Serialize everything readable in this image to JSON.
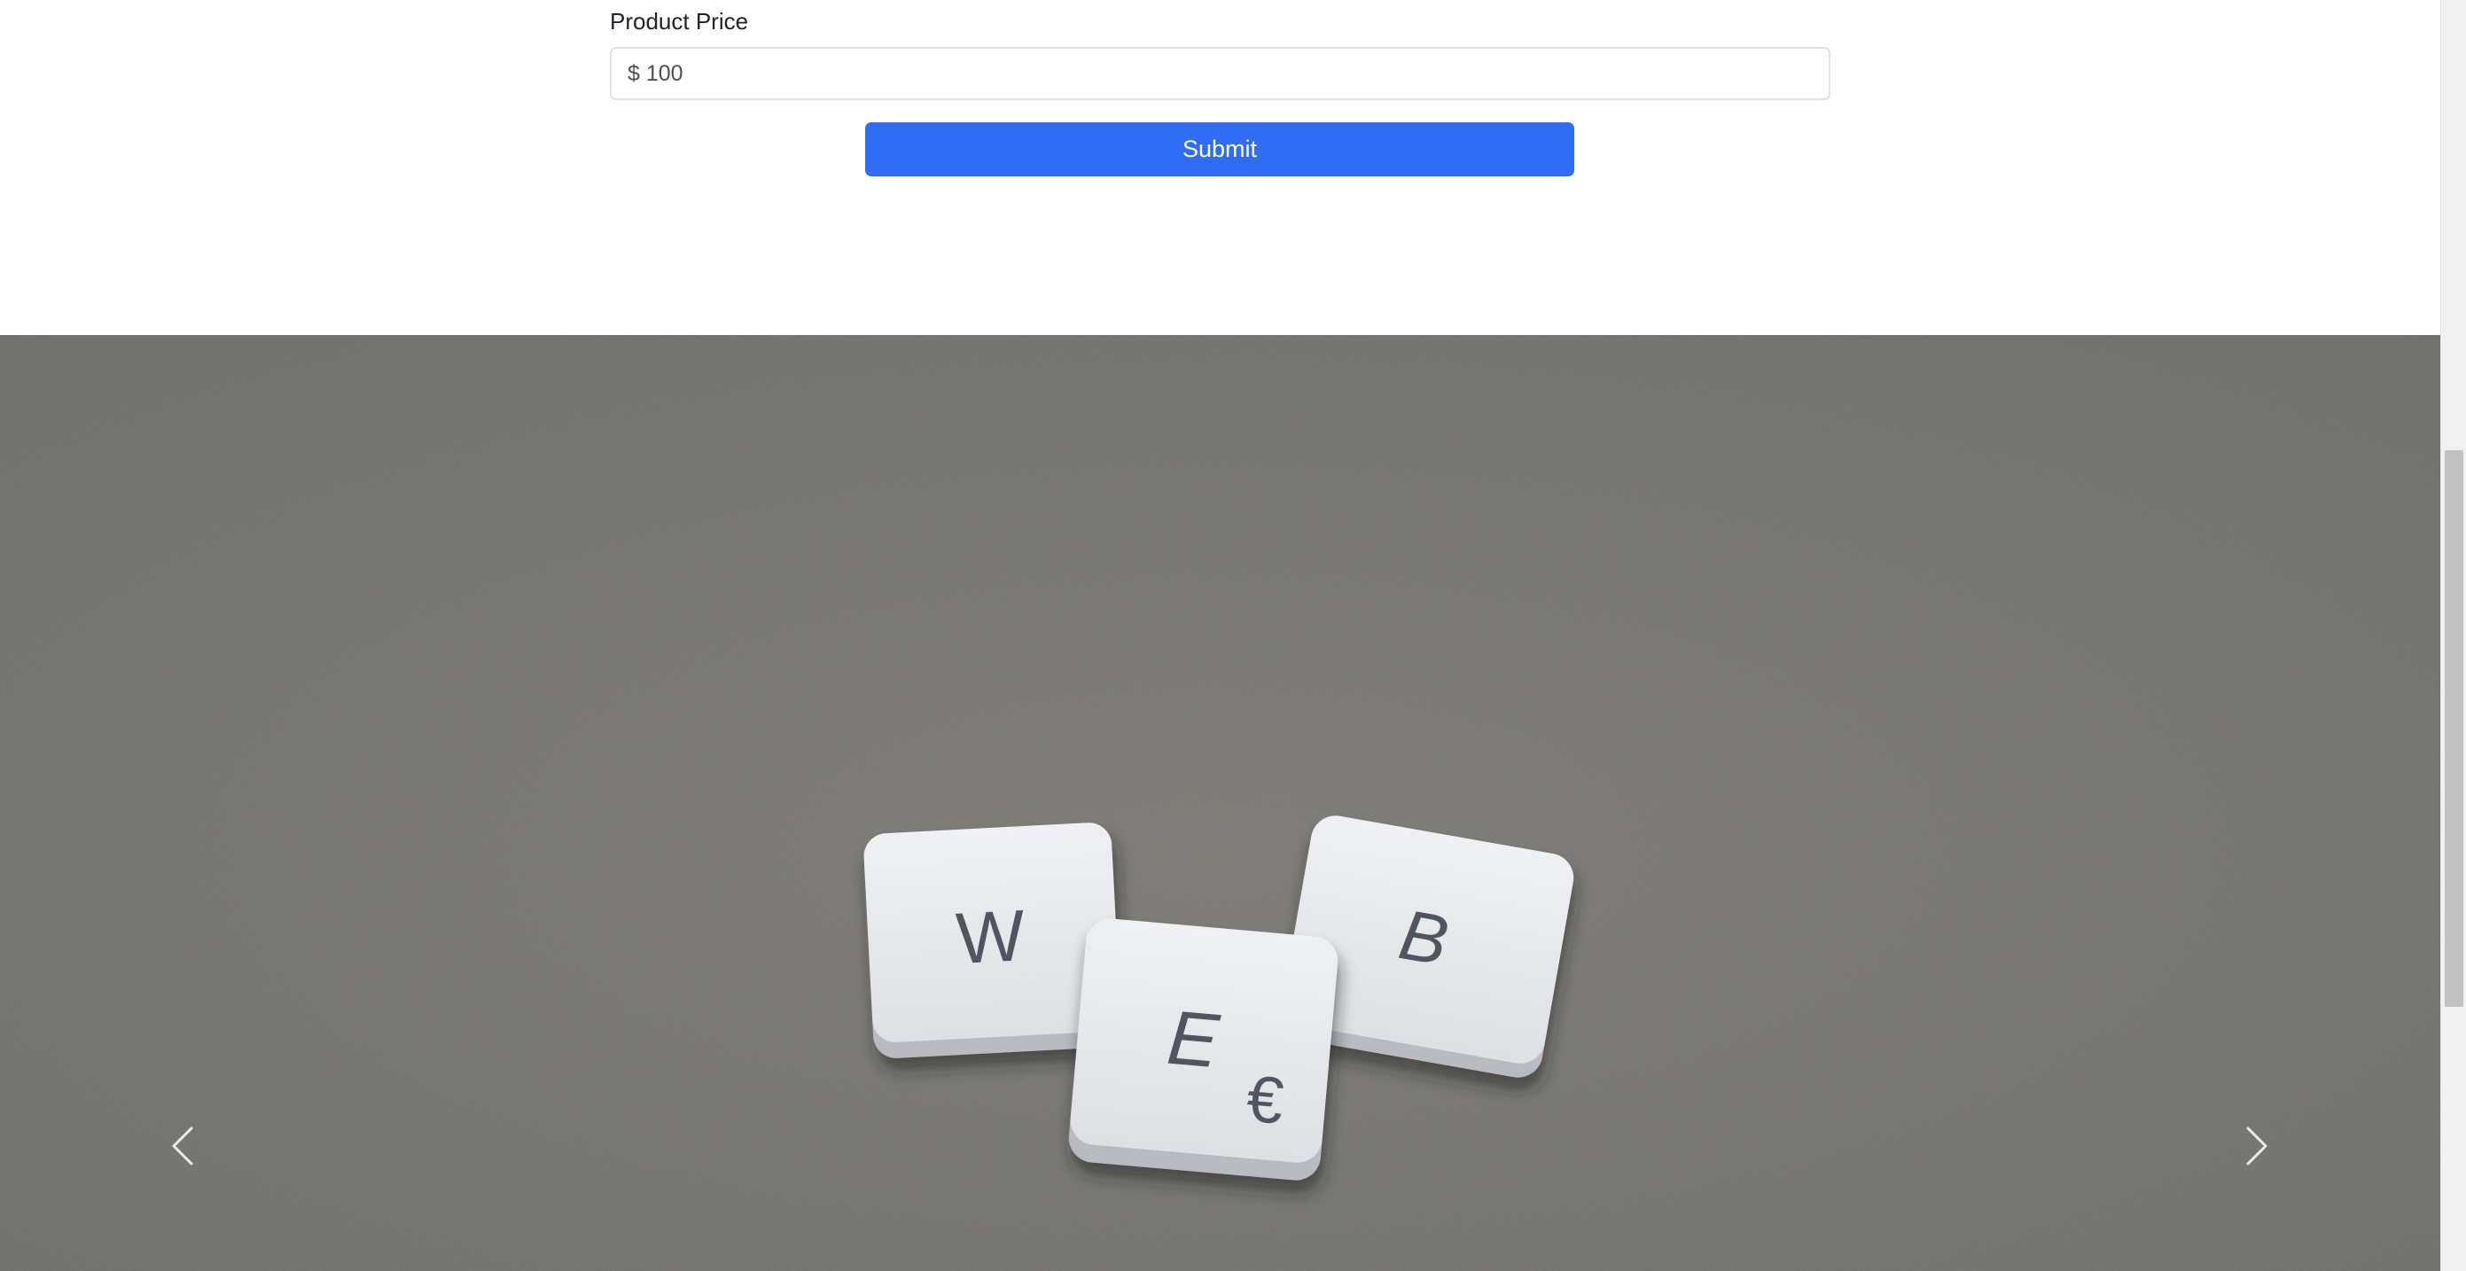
{
  "form": {
    "price_label": "Product Price",
    "price_value": "$ 100",
    "submit_label": "Submit"
  },
  "carousel": {
    "tiles": [
      {
        "letter": "W"
      },
      {
        "letter": "B"
      },
      {
        "letter": "E"
      },
      {
        "symbol": "€"
      }
    ],
    "prev_icon": "chevron-left-icon",
    "next_icon": "chevron-right-icon",
    "background_color": "#78766f",
    "tile_color": "#e9ebee"
  },
  "colors": {
    "accent": "#316df2",
    "text": "#212529",
    "border": "#dee2e6"
  }
}
